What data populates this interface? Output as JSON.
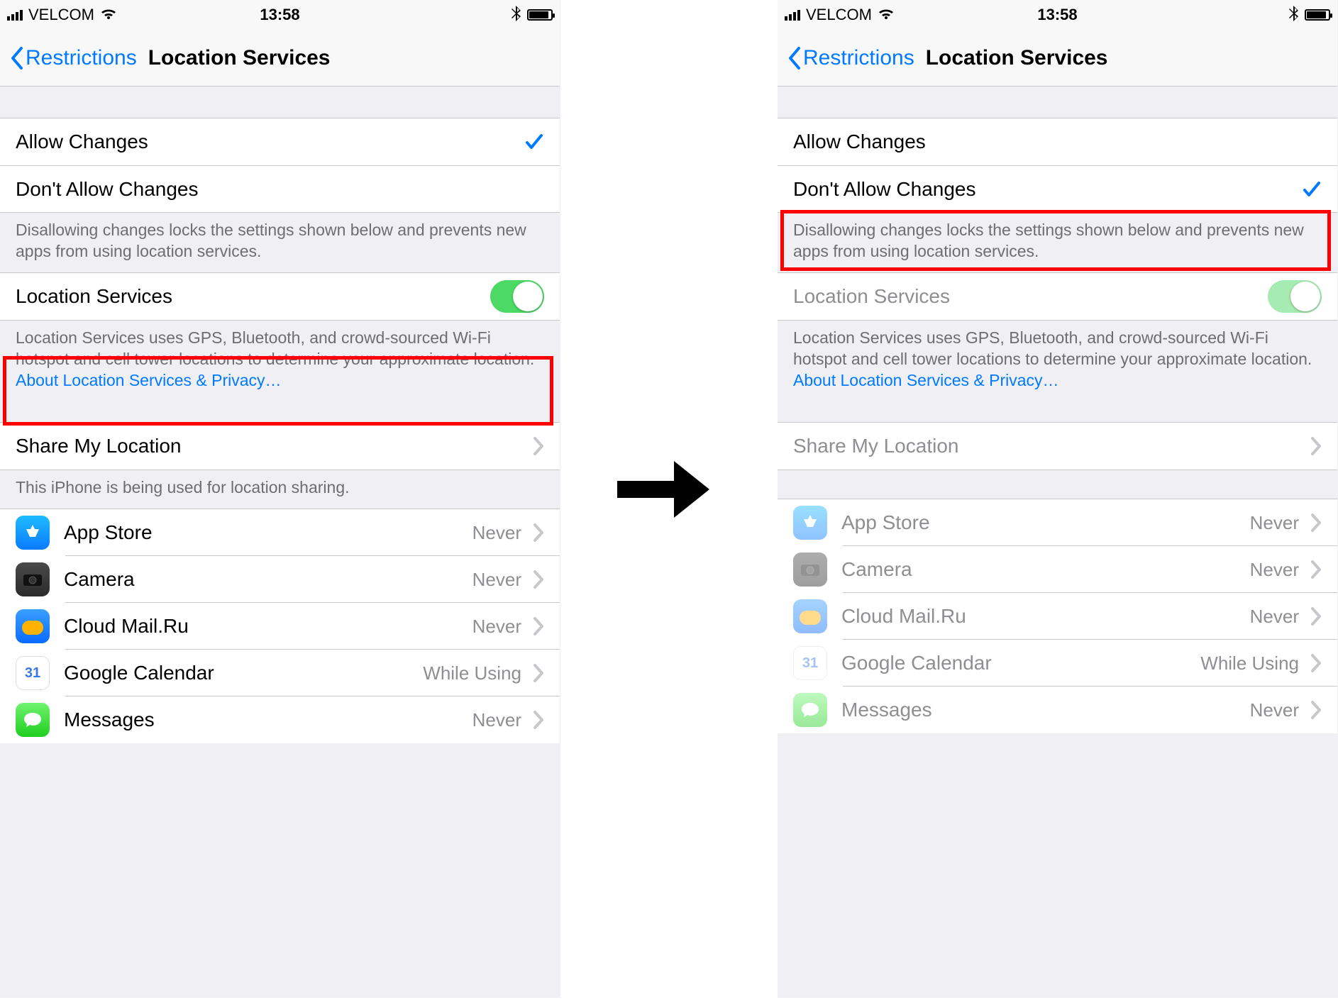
{
  "status": {
    "carrier": "VELCOM",
    "time": "13:58"
  },
  "nav": {
    "back_label": "Restrictions",
    "title": "Location Services"
  },
  "options": {
    "allow": "Allow Changes",
    "dont_allow": "Don't Allow Changes"
  },
  "footers": {
    "changes": "Disallowing changes locks the settings shown below and prevents new apps from using location services.",
    "loc_desc": "Location Services uses GPS, Bluetooth, and crowd-sourced Wi-Fi hotspot and cell tower locations to determine your approximate location. ",
    "loc_link": "About Location Services & Privacy…",
    "sharing": "This iPhone is being used for location sharing."
  },
  "rows": {
    "location_services": "Location Services",
    "share_location": "Share My Location"
  },
  "apps": [
    {
      "name": "App Store",
      "value": "Never",
      "icon": "appstore",
      "glyph": "A"
    },
    {
      "name": "Camera",
      "value": "Never",
      "icon": "camera",
      "glyph": "📷"
    },
    {
      "name": "Cloud Mail.Ru",
      "value": "Never",
      "icon": "cloudmail",
      "glyph": ""
    },
    {
      "name": "Google Calendar",
      "value": "While Using",
      "icon": "gcal",
      "glyph": "31"
    },
    {
      "name": "Messages",
      "value": "Never",
      "icon": "messages",
      "glyph": "💬"
    }
  ],
  "gcal_glyph": "31"
}
